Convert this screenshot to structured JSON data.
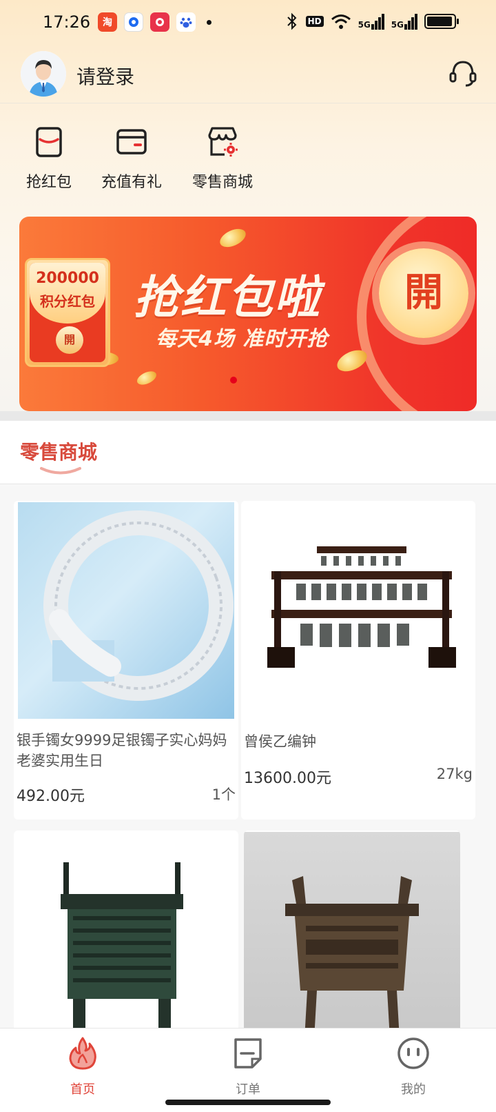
{
  "status_bar": {
    "time": "17:26",
    "notification_apps": [
      "taobao-app-icon",
      "blue-app-icon",
      "weibo-app-icon",
      "baidu-app-icon"
    ],
    "hd_label": "HD",
    "signal1_label": "5G",
    "signal2_label": "5G"
  },
  "header": {
    "login_text": "请登录"
  },
  "quick_menu": [
    {
      "label": "抢红包",
      "icon": "red-envelope-icon"
    },
    {
      "label": "充值有礼",
      "icon": "wallet-icon"
    },
    {
      "label": "零售商城",
      "icon": "store-icon"
    }
  ],
  "banner": {
    "envelope_amount": "200000",
    "envelope_subtitle": "积分红包",
    "envelope_open": "開",
    "title": "抢红包啦",
    "subtitle": "每天4场 准时开抢",
    "open_button": "開",
    "slide_count": 1,
    "active_slide": 1
  },
  "section": {
    "title": "零售商城"
  },
  "products": [
    {
      "title": "银手镯女9999足银镯子实心妈妈老婆实用生日",
      "price": "492.00元",
      "meta": "1个",
      "image": "silver-bracelet"
    },
    {
      "title": "曾侯乙编钟",
      "price": "13600.00元",
      "meta": "27kg",
      "image": "bronze-chime-bells"
    },
    {
      "title": "",
      "price": "",
      "meta": "",
      "image": "green-bronze-ding"
    },
    {
      "title": "",
      "price": "",
      "meta": "",
      "image": "bronze-ding-vessel"
    }
  ],
  "tabbar": [
    {
      "label": "首页",
      "icon": "flame-icon",
      "active": true
    },
    {
      "label": "订单",
      "icon": "document-icon",
      "active": false
    },
    {
      "label": "我的",
      "icon": "smiley-icon",
      "active": false
    }
  ],
  "colors": {
    "accent": "#e0453a",
    "section_title": "#d84a3c",
    "banner_red": "#ef2b27",
    "banner_orange": "#fb7a3a"
  }
}
